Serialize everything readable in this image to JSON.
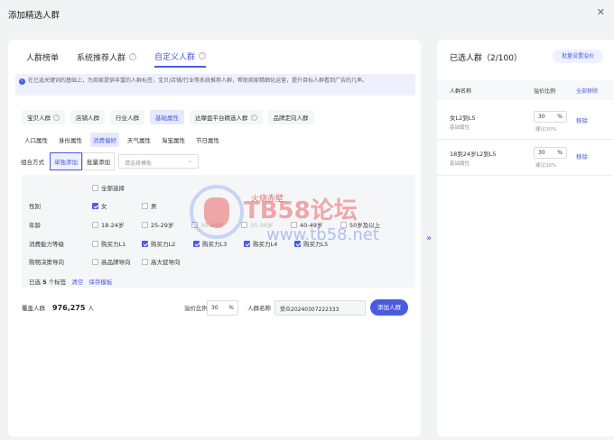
{
  "modal": {
    "title": "添加精选人群",
    "close_icon": "close-icon"
  },
  "tabs": [
    {
      "label": "人群榜单",
      "active": false,
      "help": false
    },
    {
      "label": "系统推荐人群",
      "active": false,
      "help": true
    },
    {
      "label": "自定义人群",
      "active": true,
      "help": true
    }
  ],
  "info_text": "在已选关键词的基础上，为商家提供丰富的人群标签，宝贝/店铺/行业等系统推荐人群，帮助商家精细化运营，提升目标人群看到广告的几率。",
  "subtabs": [
    {
      "label": "宝贝人群",
      "help": true,
      "active": false
    },
    {
      "label": "店铺人群",
      "help": false,
      "active": false
    },
    {
      "label": "行业人群",
      "help": false,
      "active": false
    },
    {
      "label": "基础属性",
      "help": false,
      "active": true
    },
    {
      "label": "达摩盘平台精选人群",
      "help": true,
      "active": false
    },
    {
      "label": "品牌定向人群",
      "help": false,
      "active": false
    }
  ],
  "attr_tabs": [
    {
      "label": "人口属性",
      "active": false
    },
    {
      "label": "身份属性",
      "active": false
    },
    {
      "label": "消费偏好",
      "active": true
    },
    {
      "label": "天气属性",
      "active": false
    },
    {
      "label": "淘宝属性",
      "active": false
    },
    {
      "label": "节日属性",
      "active": false
    }
  ],
  "combo": {
    "label": "组合方式",
    "single": "单独添加",
    "batch": "批量添加",
    "template_placeholder": "请选择模板"
  },
  "panel": {
    "select_all": "全部选择",
    "gender": {
      "label": "性别",
      "options": [
        {
          "label": "女",
          "checked": true
        },
        {
          "label": "男",
          "checked": false
        }
      ]
    },
    "age": {
      "label": "年龄",
      "options": [
        {
          "label": "18-24岁",
          "checked": false,
          "disabled": false
        },
        {
          "label": "25-29岁",
          "checked": false,
          "disabled": false
        },
        {
          "label": "30-34岁",
          "checked": false,
          "disabled": true
        },
        {
          "label": "35-39岁",
          "checked": false,
          "disabled": true
        },
        {
          "label": "40-49岁",
          "checked": false,
          "disabled": false
        },
        {
          "label": "50岁及以上",
          "checked": false,
          "disabled": false
        }
      ]
    },
    "spending": {
      "label": "消费能力等级",
      "options": [
        {
          "label": "购买力L1",
          "checked": false
        },
        {
          "label": "购买力L2",
          "checked": true
        },
        {
          "label": "购买力L3",
          "checked": true
        },
        {
          "label": "购买力L4",
          "checked": true
        },
        {
          "label": "购买力L5",
          "checked": true
        }
      ]
    },
    "shopping": {
      "label": "购物决策导向",
      "options": [
        {
          "label": "高品牌导向",
          "checked": false
        },
        {
          "label": "高大促导向",
          "checked": false
        }
      ]
    },
    "selected_prefix": "已选",
    "selected_count": "5",
    "selected_suffix": "个标签",
    "clear": "清空",
    "save_template": "保存模板"
  },
  "footer": {
    "cover_label": "覆盖人群",
    "cover_value": "976,275",
    "cover_unit": "人",
    "premium_label": "溢价比例",
    "premium_value": "30",
    "premium_unit": "%",
    "name_label": "人群名称",
    "name_value": "受众20240307222333",
    "add_button": "添加人群"
  },
  "right": {
    "title": "已选人群（2/100）",
    "batch_button": "批量设置溢价",
    "headers": {
      "name": "人群名称",
      "ratio": "溢价比例",
      "remove_all": "全部移除"
    },
    "rows": [
      {
        "name": "女L2到L5",
        "sub": "基础属性",
        "pct": "30",
        "unit": "%",
        "suggest": "建议30%",
        "remove": "移除"
      },
      {
        "name": "18到24岁L2到L5",
        "sub": "基础属性",
        "pct": "30",
        "unit": "%",
        "suggest": "建议30%",
        "remove": "移除"
      }
    ]
  },
  "watermark": {
    "brand": "TB58论坛",
    "url": "www.tb58.net",
    "tag": "火烧赤壁"
  }
}
